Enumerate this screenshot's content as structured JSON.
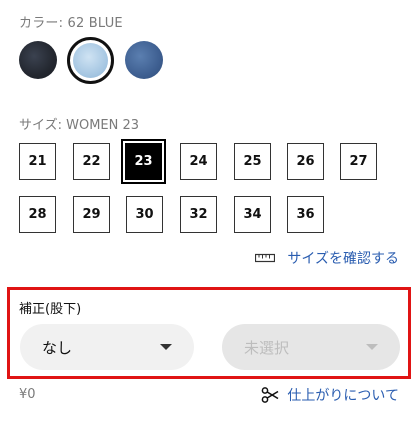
{
  "color": {
    "label": "カラー: 62 BLUE",
    "swatches": [
      {
        "name": "dark",
        "hex": "#23272f",
        "selected": false
      },
      {
        "name": "light-blue",
        "hex": "#a8c8e3",
        "selected": true
      },
      {
        "name": "blue",
        "hex": "#3e5f91",
        "selected": false
      }
    ]
  },
  "size": {
    "label": "サイズ: WOMEN 23",
    "options": [
      "21",
      "22",
      "23",
      "24",
      "25",
      "26",
      "27",
      "28",
      "29",
      "30",
      "32",
      "34",
      "36"
    ],
    "selected": "23",
    "guide_link": "サイズを確認する",
    "guide_icon": "ruler-icon"
  },
  "hem": {
    "label": "補正(股下)",
    "select_primary": "なし",
    "select_secondary": "未選択",
    "price": "¥0",
    "finish_link": "仕上がりについて",
    "finish_icon": "scissors-icon"
  },
  "colors": {
    "link": "#2a5db0",
    "highlight_border": "#e01414"
  }
}
